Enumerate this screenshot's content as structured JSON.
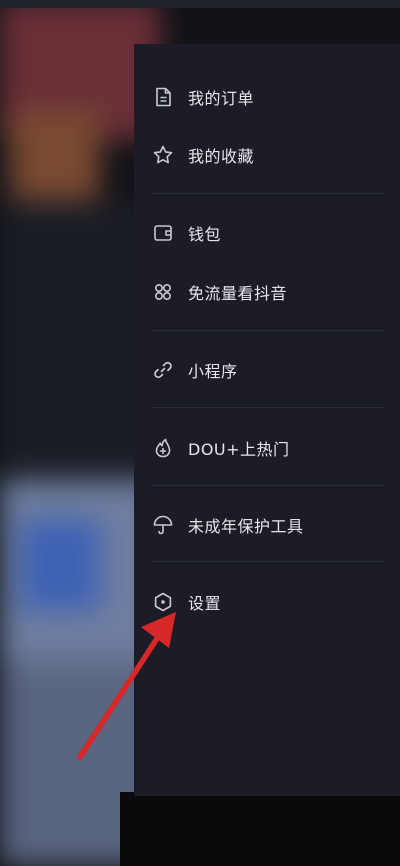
{
  "drawer": {
    "items": [
      {
        "label": "我的订单",
        "icon": "document-icon"
      },
      {
        "label": "我的收藏",
        "icon": "star-icon"
      },
      {
        "label": "钱包",
        "icon": "wallet-icon"
      },
      {
        "label": "免流量看抖音",
        "icon": "grid-petal-icon"
      },
      {
        "label": "小程序",
        "icon": "link-icon"
      },
      {
        "label": "DOU+上热门",
        "icon": "flame-plus-icon"
      },
      {
        "label": "未成年保护工具",
        "icon": "umbrella-icon"
      },
      {
        "label": "设置",
        "icon": "hexagon-settings-icon"
      }
    ]
  },
  "colors": {
    "drawer_bg": "#1b1c25",
    "text": "#e6e7ea",
    "icon": "#c9cad0",
    "divider": "#2b2d37",
    "arrow": "#d62828"
  }
}
